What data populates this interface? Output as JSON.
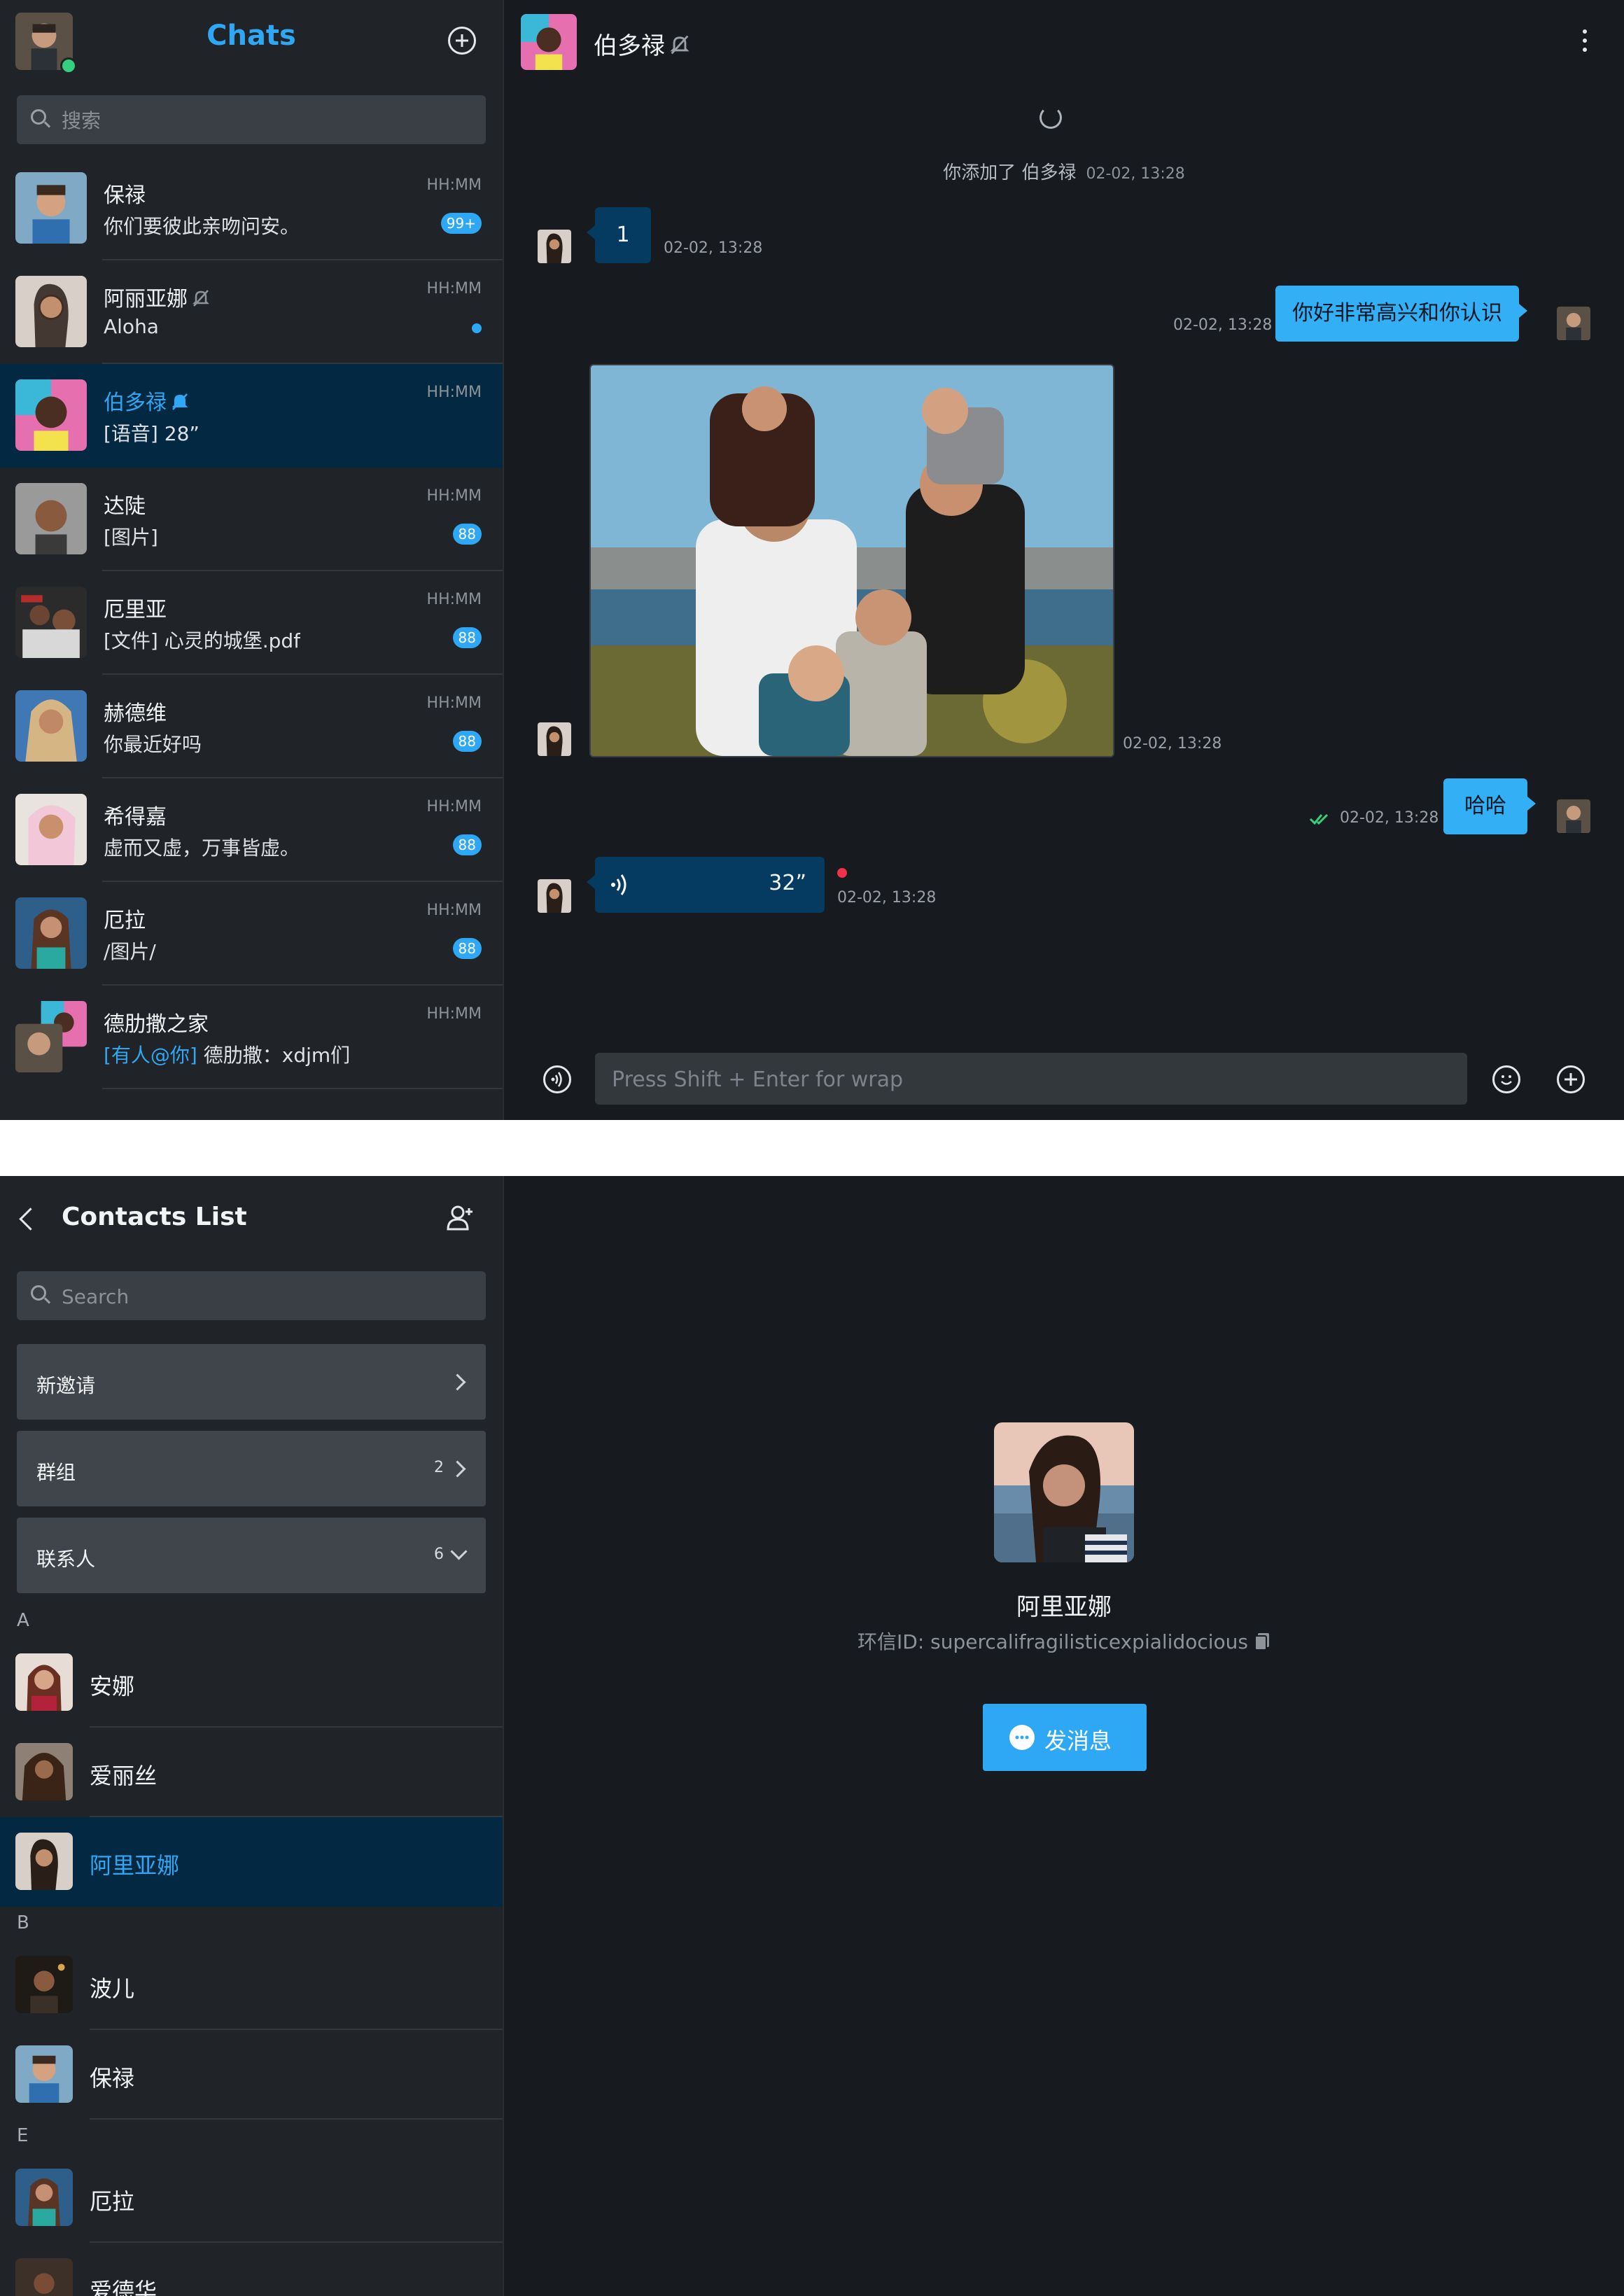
{
  "chats_panel": {
    "title": "Chats",
    "search_placeholder": "搜索",
    "conversations": [
      {
        "name": "保禄",
        "preview": "你们要彼此亲吻问安。",
        "time": "HH:MM",
        "badge": "99+"
      },
      {
        "name": "阿丽亚娜",
        "preview": "Aloha",
        "time": "HH:MM",
        "muted": true,
        "unread_dot": true
      },
      {
        "name": "伯多禄",
        "preview": "[语音] 28”",
        "time": "HH:MM",
        "muted": true,
        "active": true
      },
      {
        "name": "达陡",
        "preview": "[图片]",
        "time": "HH:MM",
        "badge": "88"
      },
      {
        "name": "厄里亚",
        "preview": "[文件] 心灵的城堡.pdf",
        "time": "HH:MM",
        "badge": "88"
      },
      {
        "name": "赫德维",
        "preview": "你最近好吗",
        "time": "HH:MM",
        "badge": "88"
      },
      {
        "name": "希得嘉",
        "preview": "虚而又虚，万事皆虚。",
        "time": "HH:MM",
        "badge": "88"
      },
      {
        "name": "厄拉",
        "preview": "/图片/",
        "time": "HH:MM",
        "badge": "88"
      },
      {
        "name": "德肋撒之家",
        "mention": "[有人@你]",
        "preview": " 德肋撒：xdjm们",
        "time": "HH:MM"
      }
    ]
  },
  "chat_window": {
    "contact_name": "伯多禄",
    "system_message": "你添加了 伯多禄",
    "system_time": "02-02, 13:28",
    "messages": [
      {
        "direction": "in",
        "type": "text",
        "text": "1",
        "time": "02-02, 13:28"
      },
      {
        "direction": "out",
        "type": "text",
        "text": "你好非常高兴和你认识",
        "time": "02-02, 13:28"
      },
      {
        "direction": "in",
        "type": "image",
        "time": "02-02, 13:28"
      },
      {
        "direction": "out",
        "type": "text",
        "text": "哈哈",
        "time": "02-02, 13:28",
        "read": true
      },
      {
        "direction": "in",
        "type": "voice",
        "duration": "32”",
        "time": "02-02, 13:28",
        "unplayed": true
      }
    ],
    "composer_placeholder": "Press Shift + Enter for wrap"
  },
  "contacts_panel": {
    "title": "Contacts List",
    "search_placeholder": "Search",
    "rows": [
      {
        "label": "新邀请"
      },
      {
        "label": "群组",
        "count": "2"
      },
      {
        "label": "联系人",
        "count": "6"
      }
    ],
    "sections": [
      {
        "letter": "A",
        "contacts": [
          "安娜",
          "爱丽丝",
          "阿里亚娜"
        ]
      },
      {
        "letter": "B",
        "contacts": [
          "波儿",
          "保禄"
        ]
      },
      {
        "letter": "E",
        "contacts": [
          "厄拉",
          "爱德华"
        ]
      }
    ],
    "selected_contact": "阿里亚娜"
  },
  "profile": {
    "name": "阿里亚娜",
    "id_line": "环信ID: supercalifragilisticexpialidocious",
    "send_label": "发消息"
  },
  "colors": {
    "accent": "#2ea8f5",
    "background": "#171a1e",
    "sidebar": "#202327",
    "active_row": "#032841",
    "incoming_bubble": "#053a61",
    "outgoing_bubble": "#33aff5",
    "badge": "#2ea8f5",
    "online": "#35d07f",
    "unplayed": "#f0334a"
  }
}
